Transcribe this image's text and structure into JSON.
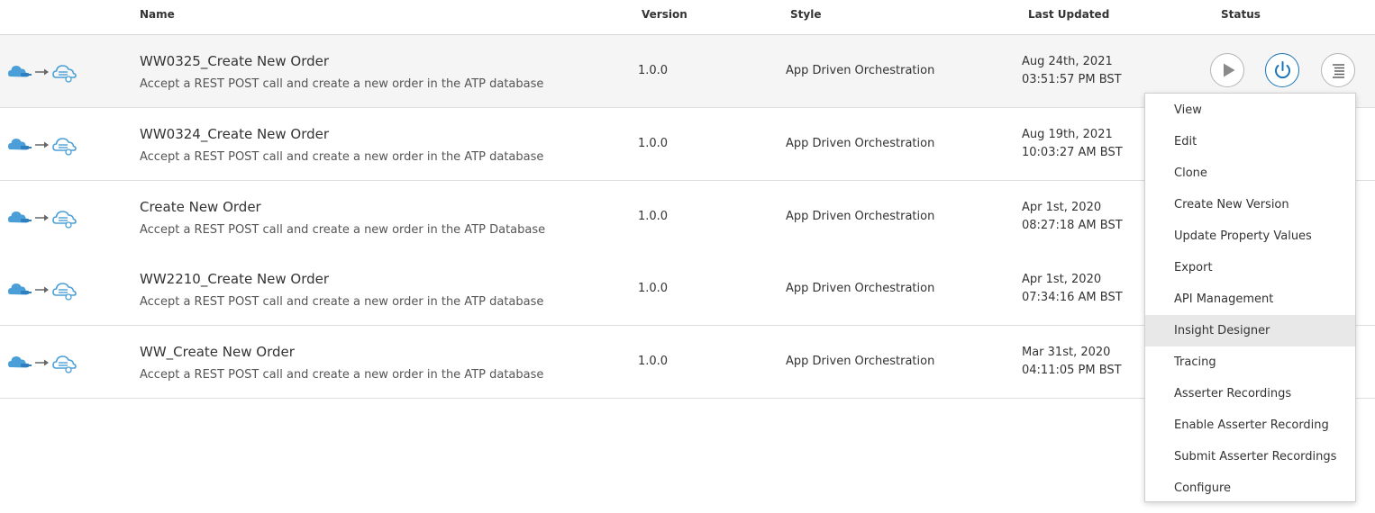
{
  "table": {
    "headers": {
      "name": "Name",
      "version": "Version",
      "style": "Style",
      "last_updated": "Last Updated",
      "status": "Status"
    },
    "rows": [
      {
        "name": "WW0325_Create New Order",
        "description": "Accept a REST POST call and create a new order in the ATP database",
        "version": "1.0.0",
        "style": "App Driven Orchestration",
        "date": "Aug 24th, 2021",
        "time": "03:51:57 PM BST"
      },
      {
        "name": "WW0324_Create New Order",
        "description": "Accept a REST POST call and create a new order in the ATP database",
        "version": "1.0.0",
        "style": "App Driven Orchestration",
        "date": "Aug 19th, 2021",
        "time": "10:03:27 AM BST"
      },
      {
        "name": "Create New Order",
        "description": "Accept a REST POST call and create a new order in the ATP Database",
        "version": "1.0.0",
        "style": "App Driven Orchestration",
        "date": "Apr 1st, 2020",
        "time": "08:27:18 AM BST"
      },
      {
        "name": "WW2210_Create New Order",
        "description": "Accept a REST POST call and create a new order in the ATP database",
        "version": "1.0.0",
        "style": "App Driven Orchestration",
        "date": "Apr 1st, 2020",
        "time": "07:34:16 AM BST"
      },
      {
        "name": "WW_Create New Order",
        "description": "Accept a REST POST call and create a new order in the ATP database",
        "version": "1.0.0",
        "style": "App Driven Orchestration",
        "date": "Mar 31st, 2020",
        "time": "04:11:05 PM BST"
      }
    ]
  },
  "row_icons": [
    "cloud-trigger-icon",
    "arrow-right-icon",
    "cloud-invoke-icon"
  ],
  "row_actions": [
    "run-icon",
    "power-icon",
    "hamburger-menu-icon"
  ],
  "actions_menu": {
    "items": [
      "View",
      "Edit",
      "Clone",
      "Create New Version",
      "Update Property Values",
      "Export",
      "API Management",
      "Insight Designer",
      "Tracing",
      "Asserter Recordings",
      "Enable Asserter Recording",
      "Submit Asserter Recordings",
      "Configure"
    ],
    "highlighted": "Insight Designer"
  },
  "colors": {
    "accent": "#1b74b5",
    "cloud_icon": "#4a9fd8",
    "selected_row": "#f5f5f5",
    "menu_hover": "#e8e8e8"
  }
}
